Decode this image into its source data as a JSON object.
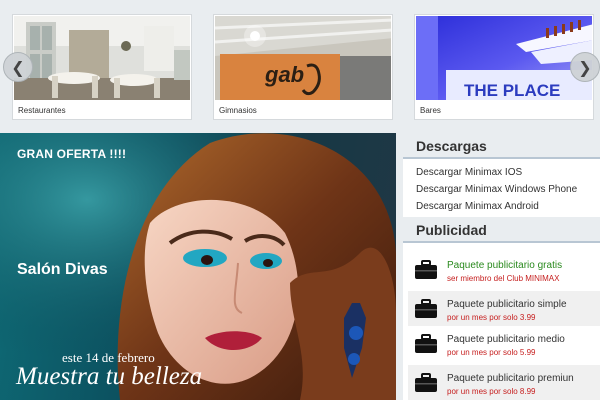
{
  "carousel": {
    "prev_icon": "chevron-left-icon",
    "next_icon": "chevron-right-icon",
    "prev_glyph": "❮",
    "next_glyph": "❯",
    "items": [
      {
        "caption": "Restaurantes"
      },
      {
        "caption": "Gimnasios",
        "sign": "gab"
      },
      {
        "caption": "Bares",
        "sign": "THE PLACE"
      }
    ]
  },
  "banner": {
    "offer": "GRAN OFERTA !!!!",
    "salon": "Salón Divas",
    "date": "este 14 de febrero",
    "tagline": "Muestra tu belleza"
  },
  "sidebar": {
    "downloads_title": "Descargas",
    "downloads": [
      "Descargar Minimax IOS",
      "Descargar Minimax Windows Phone",
      "Descargar Minimax Android"
    ],
    "ads_title": "Publicidad",
    "ads": [
      {
        "title": "Paquete publicitario gratis",
        "subtitle": "ser miembro del Club MINIMAX"
      },
      {
        "title": "Paquete publicitario simple",
        "subtitle": "por un mes por solo 3.99"
      },
      {
        "title": "Paquete publicitario medio",
        "subtitle": "por un mes por solo 5.99"
      },
      {
        "title": "Paquete publicitario premiun",
        "subtitle": "por un mes por solo 8.99"
      }
    ]
  },
  "colors": {
    "background": "#e9edf0",
    "free_title": "#2a8a1e",
    "price_text": "#c62020",
    "section_rule": "#b8c6d3"
  }
}
